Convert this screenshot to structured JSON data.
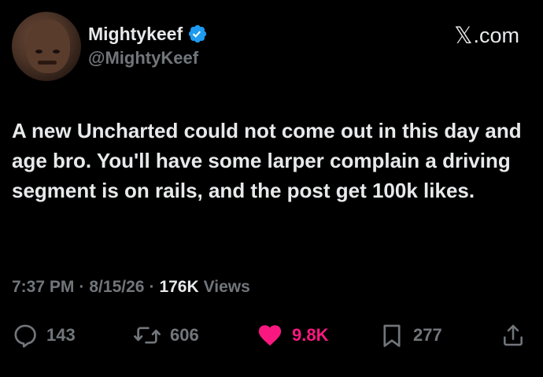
{
  "author": {
    "display_name": "Mightykeef",
    "handle": "@MightyKeef",
    "verified": true,
    "verified_color": "#1d9bf0",
    "avatar_icon": "profile-photo"
  },
  "source": {
    "logo_glyph": "𝕏",
    "label": ".com"
  },
  "tweet": {
    "text": "A new Uncharted could not come out in this day and age bro. You'll have some larper complain a driving segment is on rails, and the post get 100k likes."
  },
  "meta": {
    "time": "7:37 PM",
    "sep1": "·",
    "date": "8/15/26",
    "sep2": "·",
    "views_count": "176K",
    "views_label": "Views"
  },
  "actions": {
    "replies": "143",
    "reposts": "606",
    "likes": "9.8K",
    "bookmarks": "277"
  },
  "colors": {
    "background": "#000000",
    "text": "#e7e9ea",
    "muted": "#71767b",
    "like": "#f91880"
  }
}
